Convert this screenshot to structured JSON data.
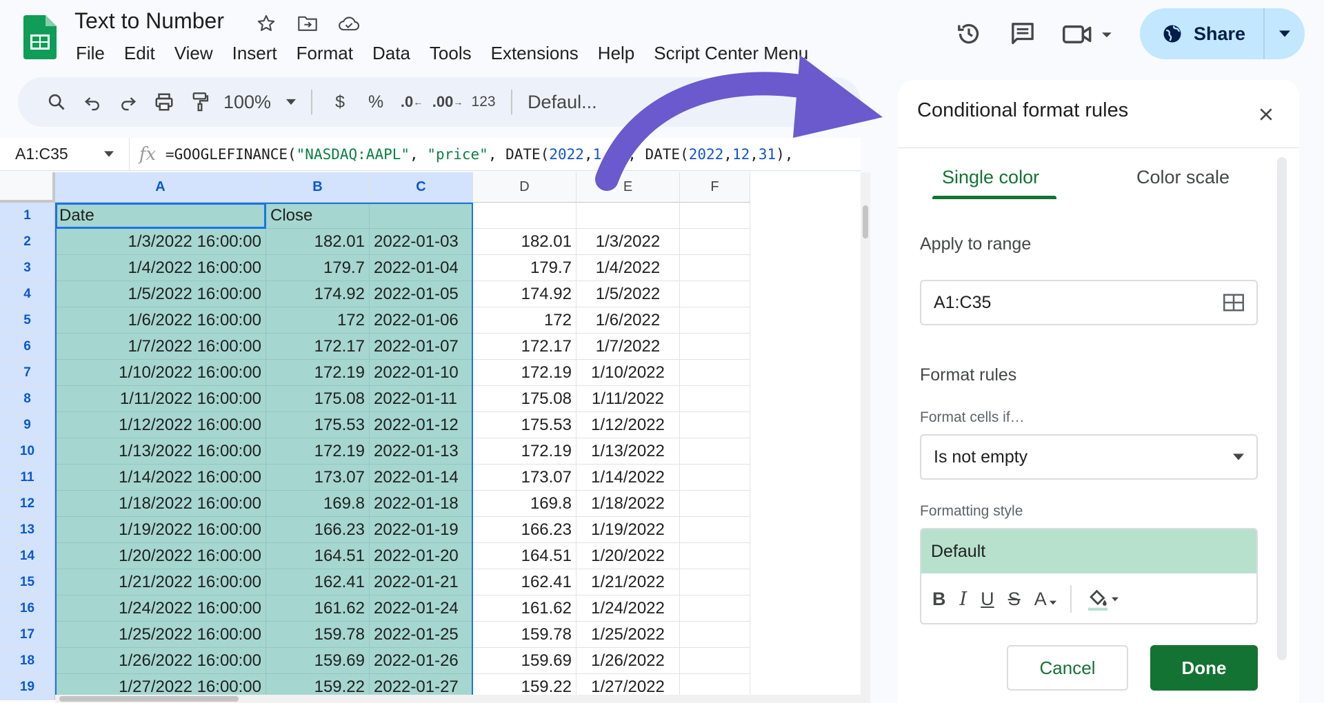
{
  "app": {
    "doc_title": "Text to Number",
    "menu": [
      "File",
      "Edit",
      "View",
      "Insert",
      "Format",
      "Data",
      "Tools",
      "Extensions",
      "Help",
      "Script Center Menu"
    ],
    "share_label": "Share",
    "accent": "#137333",
    "selection_color": "#1a73e8",
    "highlight_color": "#a5d6cf"
  },
  "toolbar": {
    "zoom": "100%",
    "currency": "$",
    "percent": "%",
    "decrease_decimals": ".0",
    "increase_decimals": ".00",
    "number_format": "123",
    "font": "Defaul..."
  },
  "formula_bar": {
    "name_box": "A1:C35",
    "formula_parts": [
      {
        "t": "=GOOGLEFINANCE(",
        "k": "fn"
      },
      {
        "t": "\"NASDAQ:AAPL\"",
        "k": "str"
      },
      {
        "t": ", ",
        "k": "fn"
      },
      {
        "t": "\"price\"",
        "k": "str"
      },
      {
        "t": ", DATE(",
        "k": "fn"
      },
      {
        "t": "2022",
        "k": "num"
      },
      {
        "t": ",",
        "k": "fn"
      },
      {
        "t": "1",
        "k": "num"
      },
      {
        "t": ",",
        "k": "fn"
      },
      {
        "t": "1",
        "k": "num"
      },
      {
        "t": "), DATE(",
        "k": "fn"
      },
      {
        "t": "2022",
        "k": "num"
      },
      {
        "t": ",",
        "k": "fn"
      },
      {
        "t": "12",
        "k": "num"
      },
      {
        "t": ",",
        "k": "fn"
      },
      {
        "t": "31",
        "k": "num"
      },
      {
        "t": "),",
        "k": "fn"
      }
    ]
  },
  "sheet": {
    "columns": [
      "A",
      "B",
      "C",
      "D",
      "E",
      "F"
    ],
    "header_row": [
      "Date",
      "Close",
      "",
      "",
      "",
      ""
    ],
    "rows": [
      [
        "1/3/2022 16:00:00",
        "182.01",
        "2022-01-03",
        "182.01",
        "1/3/2022"
      ],
      [
        "1/4/2022 16:00:00",
        "179.7",
        "2022-01-04",
        "179.7",
        "1/4/2022"
      ],
      [
        "1/5/2022 16:00:00",
        "174.92",
        "2022-01-05",
        "174.92",
        "1/5/2022"
      ],
      [
        "1/6/2022 16:00:00",
        "172",
        "2022-01-06",
        "172",
        "1/6/2022"
      ],
      [
        "1/7/2022 16:00:00",
        "172.17",
        "2022-01-07",
        "172.17",
        "1/7/2022"
      ],
      [
        "1/10/2022 16:00:00",
        "172.19",
        "2022-01-10",
        "172.19",
        "1/10/2022"
      ],
      [
        "1/11/2022 16:00:00",
        "175.08",
        "2022-01-11",
        "175.08",
        "1/11/2022"
      ],
      [
        "1/12/2022 16:00:00",
        "175.53",
        "2022-01-12",
        "175.53",
        "1/12/2022"
      ],
      [
        "1/13/2022 16:00:00",
        "172.19",
        "2022-01-13",
        "172.19",
        "1/13/2022"
      ],
      [
        "1/14/2022 16:00:00",
        "173.07",
        "2022-01-14",
        "173.07",
        "1/14/2022"
      ],
      [
        "1/18/2022 16:00:00",
        "169.8",
        "2022-01-18",
        "169.8",
        "1/18/2022"
      ],
      [
        "1/19/2022 16:00:00",
        "166.23",
        "2022-01-19",
        "166.23",
        "1/19/2022"
      ],
      [
        "1/20/2022 16:00:00",
        "164.51",
        "2022-01-20",
        "164.51",
        "1/20/2022"
      ],
      [
        "1/21/2022 16:00:00",
        "162.41",
        "2022-01-21",
        "162.41",
        "1/21/2022"
      ],
      [
        "1/24/2022 16:00:00",
        "161.62",
        "2022-01-24",
        "161.62",
        "1/24/2022"
      ],
      [
        "1/25/2022 16:00:00",
        "159.78",
        "2022-01-25",
        "159.78",
        "1/25/2022"
      ],
      [
        "1/26/2022 16:00:00",
        "159.69",
        "2022-01-26",
        "159.69",
        "1/26/2022"
      ],
      [
        "1/27/2022 16:00:00",
        "159.22",
        "2022-01-27",
        "159.22",
        "1/27/2022"
      ]
    ]
  },
  "panel": {
    "title": "Conditional format rules",
    "tab_single": "Single color",
    "tab_scale": "Color scale",
    "apply_label": "Apply to range",
    "range_value": "A1:C35",
    "rules_label": "Format rules",
    "cells_if_label": "Format cells if…",
    "condition": "Is not empty",
    "style_label": "Formatting style",
    "style_preview": "Default",
    "style_preview_color": "#b7e1cd",
    "cancel": "Cancel",
    "done": "Done"
  },
  "annotation": {
    "arrow_color": "#6a5acd"
  }
}
